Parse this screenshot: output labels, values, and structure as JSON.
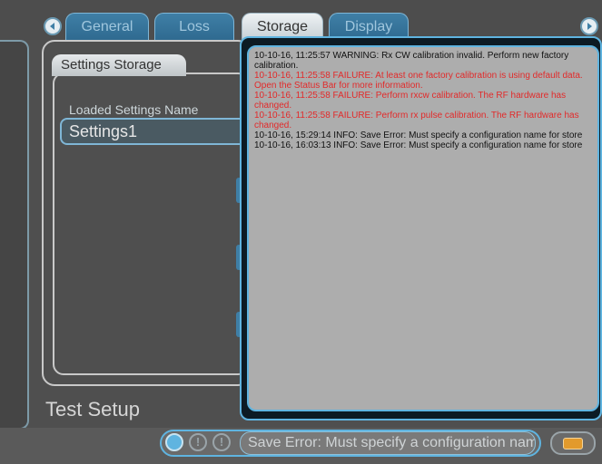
{
  "tabs": [
    {
      "label": "General",
      "active": false
    },
    {
      "label": "Loss",
      "active": false
    },
    {
      "label": "Storage",
      "active": true
    },
    {
      "label": "Display",
      "active": false
    }
  ],
  "section": {
    "title": "Settings Storage",
    "field_label": "Loaded Settings Name",
    "field_value": "Settings1"
  },
  "footer_title": "Test Setup",
  "log": [
    {
      "text": "10-10-16, 11:25:57 WARNING: Rx CW calibration invalid. Perform new factory calibration.",
      "level": "info"
    },
    {
      "text": "10-10-16, 11:25:58 FAILURE: At least one factory calibration is using default data. Open the Status Bar for more information.",
      "level": "fail"
    },
    {
      "text": "10-10-16, 11:25:58 FAILURE: Perform rxcw calibration. The RF hardware has changed.",
      "level": "fail"
    },
    {
      "text": "10-10-16, 11:25:58 FAILURE: Perform rx pulse calibration. The RF hardware has changed.",
      "level": "fail"
    },
    {
      "text": "10-10-16, 15:29:14 INFO: Save Error: Must specify a configuration name for store",
      "level": "info"
    },
    {
      "text": "10-10-16, 16:03:13 INFO: Save Error: Must specify a configuration name for store",
      "level": "info"
    }
  ],
  "status": {
    "message": "Save Error: Must specify a configuration name for store",
    "icons": [
      "status-indicator-icon",
      "info-icon",
      "warning-icon"
    ]
  },
  "colors": {
    "accent": "#5fb4e0",
    "failure_text": "#e22a2a",
    "battery": "#e29a2c"
  }
}
